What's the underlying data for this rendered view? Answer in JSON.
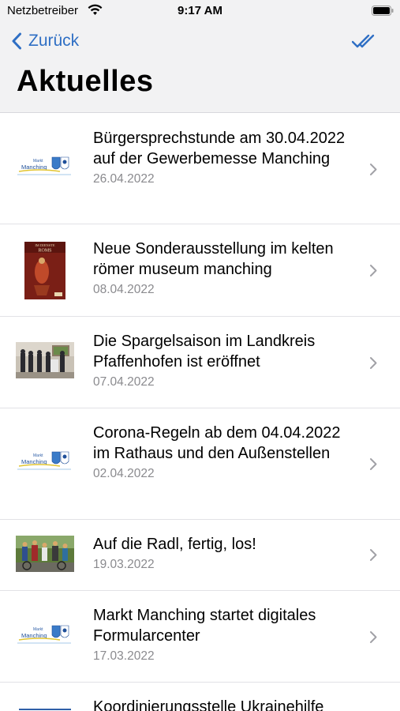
{
  "status_bar": {
    "carrier": "Netzbetreiber",
    "time": "9:17 AM"
  },
  "nav": {
    "back_label": "Zurück",
    "title": "Aktuelles",
    "mark_all_read_icon": "double-checkmark-icon"
  },
  "colors": {
    "accent": "#2f6fc4",
    "date_gray": "#8a8a8e",
    "header_bg": "#f2f2f3"
  },
  "news": [
    {
      "title": "Bürgersprechstunde am 30.04.2022 auf der Gewerbemesse Manching",
      "date": "26.04.2022",
      "thumbnail": "markt-manching-logo"
    },
    {
      "title": "Neue Sonderausstellung im kelten römer museum manching",
      "date": "08.04.2022",
      "thumbnail": "exhibition-poster"
    },
    {
      "title": "Die Spargelsaison im Landkreis Pfaffenhofen ist eröffnet",
      "date": "07.04.2022",
      "thumbnail": "group-photo"
    },
    {
      "title": "Corona-Regeln ab dem 04.04.2022 im Rathaus und den Außenstellen",
      "date": "02.04.2022",
      "thumbnail": "markt-manching-logo"
    },
    {
      "title": "Auf die Radl, fertig, los!",
      "date": "19.03.2022",
      "thumbnail": "cyclists-photo"
    },
    {
      "title": "Markt Manching startet digitales Formularcenter",
      "date": "17.03.2022",
      "thumbnail": "markt-manching-logo"
    },
    {
      "title": "Koordinierungsstelle Ukrainehilfe",
      "date": "",
      "thumbnail": "markt-manching-logo"
    }
  ],
  "logo": {
    "small_text": "Markt",
    "name": "Manching"
  },
  "poster": {
    "line1": "IM DIENSTE",
    "line2": "ROMS"
  }
}
